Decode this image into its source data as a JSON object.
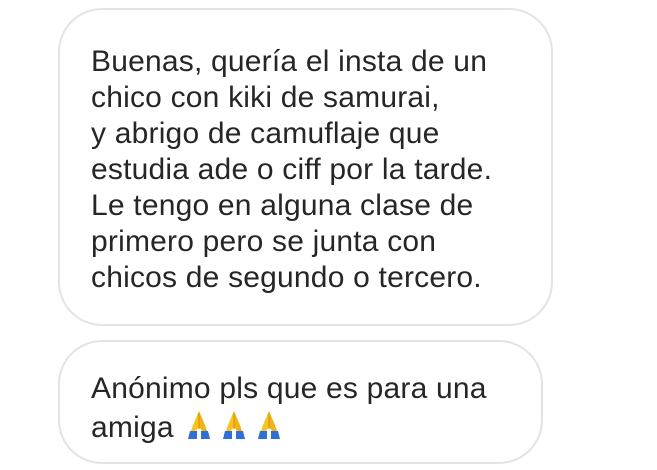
{
  "messages": [
    {
      "lines": [
        "Buenas, quería el insta de un",
        "chico con kiki de samurai,",
        "y abrigo de camuflaje que",
        "estudia ade o ciff por la tarde.",
        "Le tengo en alguna clase de",
        "primero pero se junta con",
        "chicos de segundo o tercero."
      ]
    },
    {
      "lines": [
        "Anónimo pls que es para una",
        "amiga"
      ],
      "emoji": [
        "folded-hands-icon",
        "folded-hands-icon",
        "folded-hands-icon"
      ]
    }
  ],
  "colors": {
    "bubble_border": "#e3e3e3",
    "text": "#262626",
    "emoji_yellow": "#f7c325",
    "emoji_blue": "#2f6fd6"
  }
}
